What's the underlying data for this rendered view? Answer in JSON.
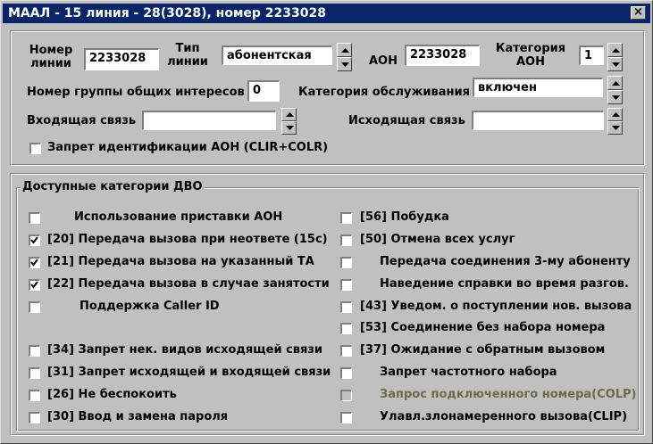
{
  "window": {
    "title": "МААЛ - 15 линия - 28(3028), номер 2233028",
    "close": "×"
  },
  "top": {
    "line_number_label_1": "Номер",
    "line_number_label_2": "линии",
    "line_number_value": "2233028",
    "line_type_label_1": "Тип",
    "line_type_label_2": "линии",
    "line_type_value": "абонентская",
    "aon_label": "АОН",
    "aon_value": "2233028",
    "aon_category_label_1": "Категория",
    "aon_category_label_2": "АОН",
    "aon_category_value": "1",
    "group_label": "Номер группы общих интересов",
    "group_value": "0",
    "service_category_label": "Категория обслуживания",
    "service_category_value": "включен",
    "incoming_label": "Входящая связь",
    "incoming_value": "",
    "outgoing_label": "Исходящая связь",
    "outgoing_value": "",
    "clir_label": "Запрет идентификации АОН (CLIR+COLR)"
  },
  "dvo": {
    "title": "Доступные категории ДВО",
    "left": [
      {
        "label": "Использование приставки АОН",
        "checked": false
      },
      {
        "label": "[20] Передача вызова  при неответе (15с)",
        "checked": true
      },
      {
        "label": "[21] Передача вызова на указанный ТА",
        "checked": true
      },
      {
        "label": "[22] Передача вызова в случае занятости",
        "checked": true
      },
      {
        "label": "Поддержка Caller ID",
        "checked": false
      },
      {
        "label": "[34] Запрет нек. видов исходящей связи",
        "checked": false
      },
      {
        "label": "[31] Запрет исходящей и входящей связи",
        "checked": false
      },
      {
        "label": "[26] Не беспокоить",
        "checked": false
      },
      {
        "label": "[30] Ввод и замена пароля",
        "checked": false
      }
    ],
    "right": [
      {
        "label": "[56] Побудка",
        "checked": false
      },
      {
        "label": "[50] Отмена всех услуг",
        "checked": false
      },
      {
        "label": "Передача соединения 3-му абоненту",
        "checked": false
      },
      {
        "label": "Наведение справки во время разгов.",
        "checked": false
      },
      {
        "label": "[43] Уведом. о поступлении нов. вызова",
        "checked": false
      },
      {
        "label": "[53] Соединение без набора номера",
        "checked": false
      },
      {
        "label": "[37] Ожидание с обратным вызовом",
        "checked": false
      },
      {
        "label": "Запрет частотного набора",
        "checked": false
      },
      {
        "label": "Запрос подключенного номера(COLP)",
        "checked": false,
        "disabled": true
      },
      {
        "label": "Улавл.злонамеренного вызова(CLIP)",
        "checked": false
      }
    ]
  }
}
